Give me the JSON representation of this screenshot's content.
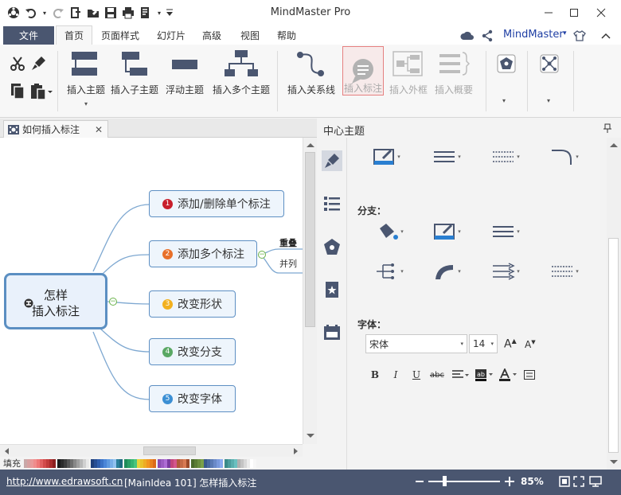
{
  "window": {
    "title": "MindMaster Pro",
    "brand": "MindMaster",
    "brand_caret": "▾"
  },
  "menu": {
    "file": "文件",
    "tabs": [
      "首页",
      "页面样式",
      "幻灯片",
      "高级",
      "视图",
      "帮助"
    ]
  },
  "ribbon": {
    "buttons": [
      {
        "label": "插入主题",
        "dropdown": "▾"
      },
      {
        "label": "插入子主题"
      },
      {
        "label": "浮动主题"
      },
      {
        "label": "插入多个主题"
      },
      {
        "label": "插入关系线"
      },
      {
        "label": "插入标注"
      },
      {
        "label": "插入外框"
      },
      {
        "label": "插入概要"
      }
    ],
    "dropdown_arrow": "▾"
  },
  "document_tab": {
    "title": "如何插入标注",
    "close": "✕"
  },
  "mindmap": {
    "central": {
      "line1": "怎样",
      "line2": "插入标注"
    },
    "topics": [
      {
        "num": "1",
        "label": "添加/删除单个标注",
        "color": "#c81e2b"
      },
      {
        "num": "2",
        "label": "添加多个标注",
        "color": "#e8702a"
      },
      {
        "num": "3",
        "label": "改变形状",
        "color": "#f2b01e"
      },
      {
        "num": "4",
        "label": "改变分支",
        "color": "#5aa864"
      },
      {
        "num": "5",
        "label": "改变字体",
        "color": "#3b8fd4"
      }
    ],
    "sub_topics": [
      "重叠",
      "并列"
    ],
    "toggle_minus": "−"
  },
  "palette": {
    "label": "填充"
  },
  "panel": {
    "title": "中心主题",
    "branch_label": "分支：",
    "font_label": "字体：",
    "font_name": "宋体",
    "font_size": "14",
    "caret": "▾",
    "format_buttons": [
      "B",
      "I",
      "U",
      "abc"
    ]
  },
  "status": {
    "url": "http://www.edrawsoft.cn",
    "info": "[MainIdea 101]  怎样插入标注",
    "zoom": "85%"
  },
  "colors": {
    "accent": "#4a5670",
    "brand": "#1f3fa4",
    "node_border": "#5d8fc3",
    "branch_line": "#7ea8d1"
  }
}
